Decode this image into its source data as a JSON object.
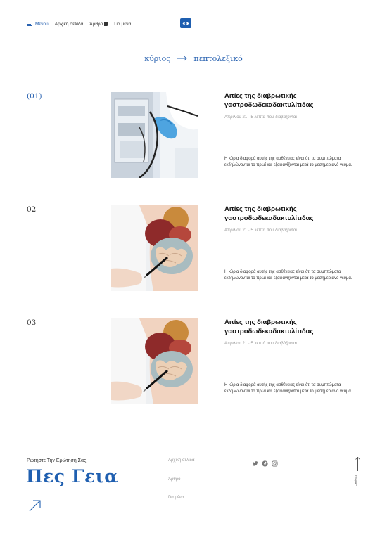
{
  "header": {
    "menu_label": "Μενού",
    "nav": [
      "Αρχική σελίδα",
      "Άρθρο",
      "Για μένα"
    ],
    "accessibility_icon": "eye-icon",
    "accent_color": "#1f5fb0"
  },
  "breadcrumb": {
    "parent": "κύριος",
    "current": "πεπτολεξικό"
  },
  "articles": [
    {
      "number": "(01)",
      "image": "endoscope-photo",
      "title": "Αιτίες της διαβρωτικής γαστροδωδεκαδακτυλίτιδας",
      "meta": "Απριλίου 21 · 5 λεπτά που διαβάζονται",
      "excerpt": "Η κύρια διαφορά αυτής της ασθένειας είναι ότι τα συμπτώματα εκδηλώνονται το πρωί και εξαφανίζονται μετά το μεσημεριανό γεύμα."
    },
    {
      "number": "02",
      "image": "anatomy-model-photo",
      "title": "Αιτίες της διαβρωτικής γαστροδωδεκαδακτυλίτιδας",
      "meta": "Απριλίου 21 · 5 λεπτά που διαβάζονται",
      "excerpt": "Η κύρια διαφορά αυτής της ασθένειας είναι ότι τα συμπτώματα εκδηλώνονται το πρωί και εξαφανίζονται μετά το μεσημεριανό γεύμα."
    },
    {
      "number": "03",
      "image": "anatomy-model-photo",
      "title": "Αιτίες της διαβρωτικής γαστροδωδεκαδακτυλίτιδας",
      "meta": "Απριλίου 21 · 5 λεπτά που διαβάζονται",
      "excerpt": "Η κύρια διαφορά αυτής της ασθένειας είναι ότι τα συμπτώματα εκδηλώνονται το πρωί και εξαφανίζονται μετά το μεσημεριανό γεύμα."
    }
  ],
  "footer": {
    "ask_label": "Ρωτήστε Την Ερώτησή Σας",
    "hello": "Πες Γεια",
    "links": [
      "Αρχική σελίδα",
      "Άρθρο",
      "Για μένα"
    ],
    "social_icons": [
      "twitter-icon",
      "facebook-icon",
      "instagram-icon"
    ],
    "up_label": "Επάνω"
  }
}
